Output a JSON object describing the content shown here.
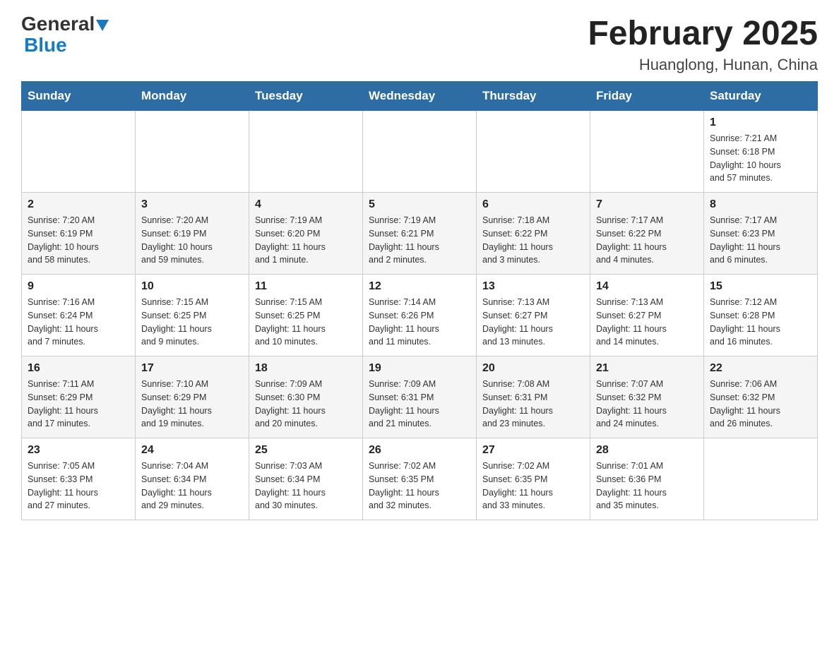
{
  "header": {
    "logo": {
      "general": "General",
      "arrow": "▶",
      "blue": "Blue"
    },
    "title": "February 2025",
    "location": "Huanglong, Hunan, China"
  },
  "days_of_week": [
    "Sunday",
    "Monday",
    "Tuesday",
    "Wednesday",
    "Thursday",
    "Friday",
    "Saturday"
  ],
  "weeks": [
    [
      {
        "day": "",
        "info": ""
      },
      {
        "day": "",
        "info": ""
      },
      {
        "day": "",
        "info": ""
      },
      {
        "day": "",
        "info": ""
      },
      {
        "day": "",
        "info": ""
      },
      {
        "day": "",
        "info": ""
      },
      {
        "day": "1",
        "info": "Sunrise: 7:21 AM\nSunset: 6:18 PM\nDaylight: 10 hours\nand 57 minutes."
      }
    ],
    [
      {
        "day": "2",
        "info": "Sunrise: 7:20 AM\nSunset: 6:19 PM\nDaylight: 10 hours\nand 58 minutes."
      },
      {
        "day": "3",
        "info": "Sunrise: 7:20 AM\nSunset: 6:19 PM\nDaylight: 10 hours\nand 59 minutes."
      },
      {
        "day": "4",
        "info": "Sunrise: 7:19 AM\nSunset: 6:20 PM\nDaylight: 11 hours\nand 1 minute."
      },
      {
        "day": "5",
        "info": "Sunrise: 7:19 AM\nSunset: 6:21 PM\nDaylight: 11 hours\nand 2 minutes."
      },
      {
        "day": "6",
        "info": "Sunrise: 7:18 AM\nSunset: 6:22 PM\nDaylight: 11 hours\nand 3 minutes."
      },
      {
        "day": "7",
        "info": "Sunrise: 7:17 AM\nSunset: 6:22 PM\nDaylight: 11 hours\nand 4 minutes."
      },
      {
        "day": "8",
        "info": "Sunrise: 7:17 AM\nSunset: 6:23 PM\nDaylight: 11 hours\nand 6 minutes."
      }
    ],
    [
      {
        "day": "9",
        "info": "Sunrise: 7:16 AM\nSunset: 6:24 PM\nDaylight: 11 hours\nand 7 minutes."
      },
      {
        "day": "10",
        "info": "Sunrise: 7:15 AM\nSunset: 6:25 PM\nDaylight: 11 hours\nand 9 minutes."
      },
      {
        "day": "11",
        "info": "Sunrise: 7:15 AM\nSunset: 6:25 PM\nDaylight: 11 hours\nand 10 minutes."
      },
      {
        "day": "12",
        "info": "Sunrise: 7:14 AM\nSunset: 6:26 PM\nDaylight: 11 hours\nand 11 minutes."
      },
      {
        "day": "13",
        "info": "Sunrise: 7:13 AM\nSunset: 6:27 PM\nDaylight: 11 hours\nand 13 minutes."
      },
      {
        "day": "14",
        "info": "Sunrise: 7:13 AM\nSunset: 6:27 PM\nDaylight: 11 hours\nand 14 minutes."
      },
      {
        "day": "15",
        "info": "Sunrise: 7:12 AM\nSunset: 6:28 PM\nDaylight: 11 hours\nand 16 minutes."
      }
    ],
    [
      {
        "day": "16",
        "info": "Sunrise: 7:11 AM\nSunset: 6:29 PM\nDaylight: 11 hours\nand 17 minutes."
      },
      {
        "day": "17",
        "info": "Sunrise: 7:10 AM\nSunset: 6:29 PM\nDaylight: 11 hours\nand 19 minutes."
      },
      {
        "day": "18",
        "info": "Sunrise: 7:09 AM\nSunset: 6:30 PM\nDaylight: 11 hours\nand 20 minutes."
      },
      {
        "day": "19",
        "info": "Sunrise: 7:09 AM\nSunset: 6:31 PM\nDaylight: 11 hours\nand 21 minutes."
      },
      {
        "day": "20",
        "info": "Sunrise: 7:08 AM\nSunset: 6:31 PM\nDaylight: 11 hours\nand 23 minutes."
      },
      {
        "day": "21",
        "info": "Sunrise: 7:07 AM\nSunset: 6:32 PM\nDaylight: 11 hours\nand 24 minutes."
      },
      {
        "day": "22",
        "info": "Sunrise: 7:06 AM\nSunset: 6:32 PM\nDaylight: 11 hours\nand 26 minutes."
      }
    ],
    [
      {
        "day": "23",
        "info": "Sunrise: 7:05 AM\nSunset: 6:33 PM\nDaylight: 11 hours\nand 27 minutes."
      },
      {
        "day": "24",
        "info": "Sunrise: 7:04 AM\nSunset: 6:34 PM\nDaylight: 11 hours\nand 29 minutes."
      },
      {
        "day": "25",
        "info": "Sunrise: 7:03 AM\nSunset: 6:34 PM\nDaylight: 11 hours\nand 30 minutes."
      },
      {
        "day": "26",
        "info": "Sunrise: 7:02 AM\nSunset: 6:35 PM\nDaylight: 11 hours\nand 32 minutes."
      },
      {
        "day": "27",
        "info": "Sunrise: 7:02 AM\nSunset: 6:35 PM\nDaylight: 11 hours\nand 33 minutes."
      },
      {
        "day": "28",
        "info": "Sunrise: 7:01 AM\nSunset: 6:36 PM\nDaylight: 11 hours\nand 35 minutes."
      },
      {
        "day": "",
        "info": ""
      }
    ]
  ]
}
